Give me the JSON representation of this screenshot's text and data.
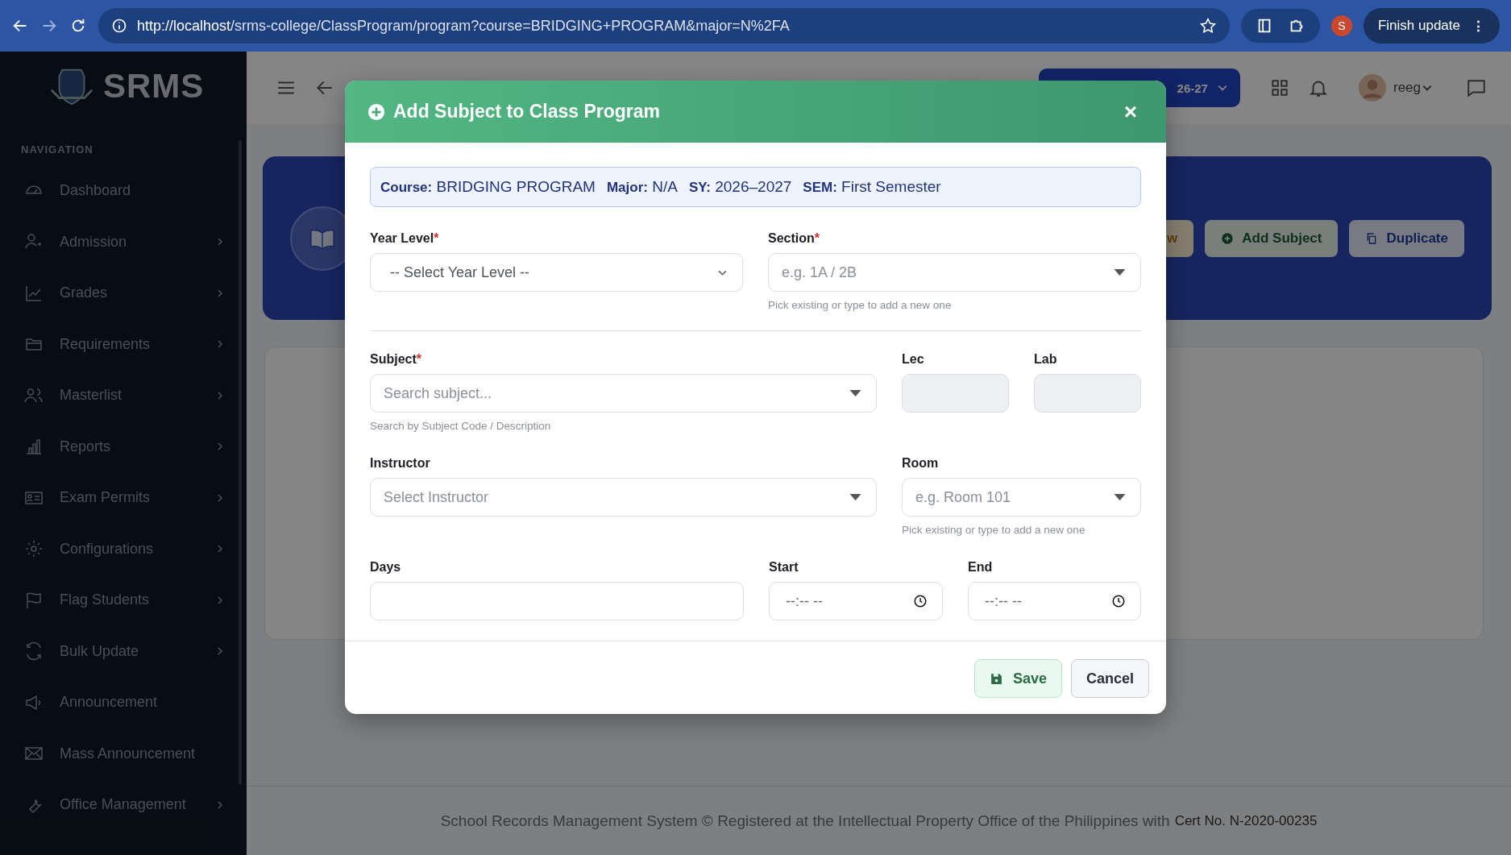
{
  "browser": {
    "url_host": "http://localhost",
    "url_path": "/srms-college/ClassProgram/program?course=BRIDGING+PROGRAM&major=N%2FA",
    "profile": "S",
    "update_button": "Finish update",
    "menu": "⋮"
  },
  "sidebar": {
    "logo": "SRMS",
    "section": "NAVIGATION",
    "items": [
      {
        "label": "Dashboard",
        "has_children": false
      },
      {
        "label": "Admission",
        "has_children": true
      },
      {
        "label": "Grades",
        "has_children": true
      },
      {
        "label": "Requirements",
        "has_children": true
      },
      {
        "label": "Masterlist",
        "has_children": true
      },
      {
        "label": "Reports",
        "has_children": true
      },
      {
        "label": "Exam Permits",
        "has_children": true
      },
      {
        "label": "Configurations",
        "has_children": true
      },
      {
        "label": "Flag Students",
        "has_children": true
      },
      {
        "label": "Bulk Update",
        "has_children": true
      },
      {
        "label": "Announcement",
        "has_children": false
      },
      {
        "label": "Mass Announcement",
        "has_children": false
      },
      {
        "label": "Office Management",
        "has_children": true
      }
    ]
  },
  "header": {
    "year_button": "26-27",
    "user": "reeg"
  },
  "banner": {
    "buttons": [
      {
        "label": "w",
        "kind": "partial"
      },
      {
        "label": "Add Subject",
        "kind": "add"
      },
      {
        "label": "Duplicate",
        "kind": "duplicate"
      }
    ]
  },
  "footer": {
    "text": "School Records Management System © Registered at the Intellectual Property Office of the Philippines with",
    "cert": "Cert No. N-2020-00235"
  },
  "modal": {
    "title": "Add Subject to Class Program",
    "close": "×",
    "info": [
      {
        "label": "Course:",
        "value": "BRIDGING PROGRAM"
      },
      {
        "label": "Major:",
        "value": "N/A"
      },
      {
        "label": "SY:",
        "value": "2026–2027"
      },
      {
        "label": "SEM:",
        "value": "First Semester"
      }
    ],
    "sections": [
      {
        "rows": [
          [
            {
              "label": "Year Level",
              "required_mark": "*",
              "kind": "select",
              "placeholder": "-- Select Year Level --",
              "disabled": false
            },
            {
              "label": "Section",
              "required_mark": "*",
              "kind": "combo",
              "placeholder": "e.g. 1A / 2B",
              "hint": "Pick existing or type to add a new one",
              "disabled": false
            }
          ]
        ]
      },
      {
        "rows": [
          [
            {
              "label": "Subject",
              "required_mark": "*",
              "kind": "combo",
              "placeholder": "Search subject...",
              "hint": "Search by Subject Code / Description",
              "disabled": false
            },
            {
              "label": "Lec",
              "kind": "text",
              "disabled": true
            },
            {
              "label": "Lab",
              "kind": "text",
              "disabled": true
            }
          ],
          [
            {
              "label": "Instructor",
              "kind": "combo",
              "placeholder": "Select Instructor",
              "disabled": false
            },
            {
              "label": "Room",
              "kind": "combo",
              "placeholder": "e.g. Room 101",
              "hint": "Pick existing or type to add a new one",
              "disabled": false
            }
          ],
          [
            {
              "label": "Days",
              "kind": "text",
              "disabled": false
            },
            {
              "label": "Start",
              "kind": "time",
              "placeholder": "--:-- --",
              "disabled": false
            },
            {
              "label": "End",
              "kind": "time",
              "placeholder": "--:-- --",
              "disabled": false
            }
          ]
        ]
      }
    ],
    "buttons": [
      {
        "label": "Save",
        "kind": "save"
      },
      {
        "label": "Cancel",
        "kind": "cancel"
      }
    ]
  }
}
